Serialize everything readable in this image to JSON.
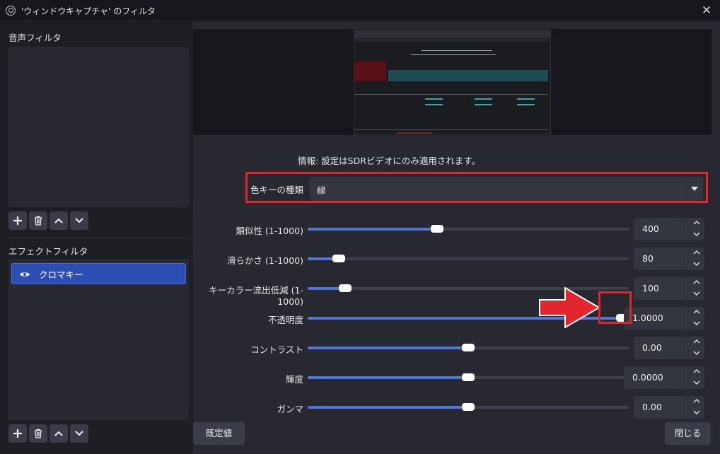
{
  "window": {
    "title": "'ウィンドウキャプチャ' のフィルタ",
    "close_glyph": "✕"
  },
  "left": {
    "audio_filters_label": "音声フィルタ",
    "effect_filters_label": "エフェクトフィルタ",
    "effect_items": [
      {
        "label": "クロマキー"
      }
    ]
  },
  "right": {
    "info": "情報: 設定はSDRビデオにのみ適用されます。",
    "key_type": {
      "label": "色キーの種類",
      "value": "緑"
    },
    "params": [
      {
        "label": "類似性 (1-1000)",
        "value": "400",
        "fraction": 0.4
      },
      {
        "label": "滑らかさ (1-1000)",
        "value": "80",
        "fraction": 0.08
      },
      {
        "label": "キーカラー流出低減 (1-1000)",
        "value": "100",
        "fraction": 0.1
      },
      {
        "label": "不透明度",
        "value": "1.0000",
        "fraction": 1.0
      },
      {
        "label": "コントラスト",
        "value": "0.00",
        "fraction": 0.5
      },
      {
        "label": "輝度",
        "value": "0.0000",
        "fraction": 0.5
      },
      {
        "label": "ガンマ",
        "value": "0.00",
        "fraction": 0.5
      }
    ],
    "defaults_button": "既定値",
    "close_button": "閉じる"
  },
  "colors": {
    "accent": "#4f76dc",
    "highlight": "#e3262e",
    "arrow": "#e3262e",
    "selection": "#2d4fb3"
  }
}
